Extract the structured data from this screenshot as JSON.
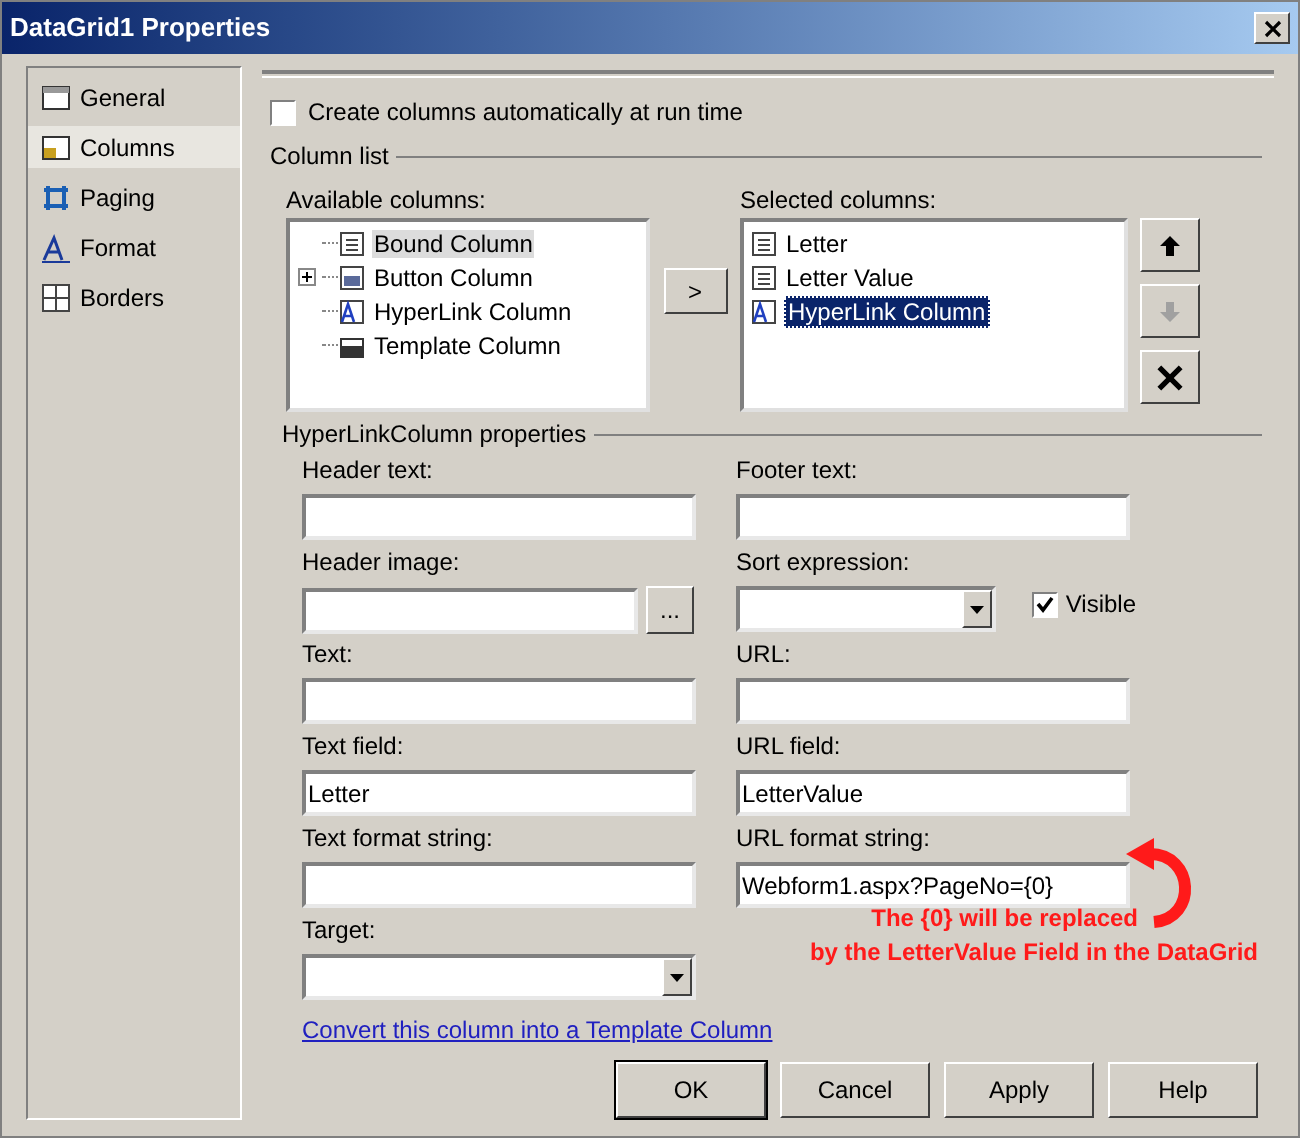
{
  "window": {
    "title": "DataGrid1 Properties"
  },
  "sidebar": {
    "items": [
      {
        "label": "General",
        "kind": "general",
        "selected": false
      },
      {
        "label": "Columns",
        "kind": "columns",
        "selected": true
      },
      {
        "label": "Paging",
        "kind": "paging",
        "selected": false
      },
      {
        "label": "Format",
        "kind": "format",
        "selected": false
      },
      {
        "label": "Borders",
        "kind": "borders",
        "selected": false
      }
    ]
  },
  "auto_columns": {
    "label": "Create columns automatically at run time",
    "checked": false
  },
  "column_list": {
    "title": "Column list",
    "available": {
      "label": "Available columns:",
      "items": [
        {
          "label": "Bound Column",
          "kind": "bound",
          "selected": true
        },
        {
          "label": "Button Column",
          "kind": "button",
          "selected": false
        },
        {
          "label": "HyperLink Column",
          "kind": "hyperlink",
          "selected": false
        },
        {
          "label": "Template Column",
          "kind": "template",
          "selected": false
        }
      ]
    },
    "add_button": ">",
    "selected_columns": {
      "label": "Selected columns:",
      "items": [
        {
          "label": "Letter",
          "kind": "bound",
          "selected": false
        },
        {
          "label": "Letter Value",
          "kind": "bound",
          "selected": false
        },
        {
          "label": "HyperLink Column",
          "kind": "hyperlink",
          "selected": true
        }
      ]
    },
    "move_buttons": [
      {
        "kind": "up",
        "disabled": false
      },
      {
        "kind": "down",
        "disabled": true
      },
      {
        "kind": "delete",
        "disabled": false
      }
    ]
  },
  "properties": {
    "title": "HyperLinkColumn properties",
    "fields": [
      {
        "label": "Header text:",
        "kind": "text"
      },
      {
        "label": "Footer text:",
        "kind": "text"
      },
      {
        "label": "Header image:",
        "kind": "browse",
        "button": "..."
      },
      {
        "label": "Sort expression:",
        "kind": "dropdown"
      },
      {
        "label": "Text:",
        "kind": "text"
      },
      {
        "label": "URL:",
        "kind": "text"
      },
      {
        "label": "Text field:",
        "kind": "text",
        "value": "Letter"
      },
      {
        "label": "URL field:",
        "kind": "text",
        "value": "LetterValue"
      },
      {
        "label": "Text format string:",
        "kind": "text"
      },
      {
        "label": "URL format string:",
        "kind": "text",
        "value": "Webform1.aspx?PageNo={0}"
      },
      {
        "label": "Target:",
        "kind": "dropdown"
      }
    ],
    "visible": {
      "label": "Visible",
      "checked": true
    },
    "convert_link": "Convert this column into a Template Column"
  },
  "annotation": {
    "lines": [
      "The {0} will be replaced",
      "by the LetterValue Field in the DataGrid"
    ]
  },
  "buttons": [
    "OK",
    "Cancel",
    "Apply",
    "Help"
  ]
}
